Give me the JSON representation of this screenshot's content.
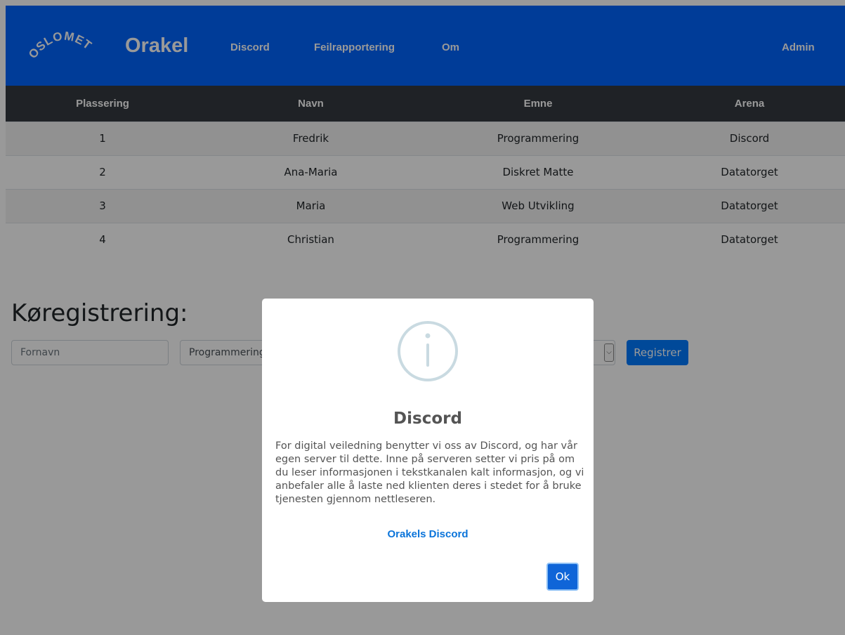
{
  "colors": {
    "navbar": "#0164fe",
    "table_header": "#343a40",
    "primary": "#007bff",
    "link": "#0a74da",
    "icon_ring": "#c9dae1"
  },
  "header": {
    "logo_text": "OSLOMET",
    "brand": "Orakel",
    "nav": {
      "discord": "Discord",
      "bug_report": "Feilrapportering",
      "about": "Om",
      "admin": "Admin"
    }
  },
  "queue_table": {
    "columns": [
      "Plassering",
      "Navn",
      "Emne",
      "Arena"
    ],
    "rows": [
      [
        "1",
        "Fredrik",
        "Programmering",
        "Discord"
      ],
      [
        "2",
        "Ana-Maria",
        "Diskret Matte",
        "Datatorget"
      ],
      [
        "3",
        "Maria",
        "Web Utvikling",
        "Datatorget"
      ],
      [
        "4",
        "Christian",
        "Programmering",
        "Datatorget"
      ]
    ]
  },
  "registration": {
    "title": "Køregistrering:",
    "name_placeholder": "Fornavn",
    "subject_value": "Programmering",
    "submit_label": "Registrer"
  },
  "modal": {
    "icon": "info-icon",
    "title": "Discord",
    "text": "For digital veiledning benytter vi oss av Discord, og har vår egen server til dette. Inne på serveren setter vi pris på om du leser informasjonen i tekstkanalen kalt informasjon, og vi anbefaler alle å laste ned klienten deres i stedet for å bruke tjenesten gjennom nettleseren.",
    "link_label": "Orakels Discord",
    "ok_label": "Ok"
  }
}
